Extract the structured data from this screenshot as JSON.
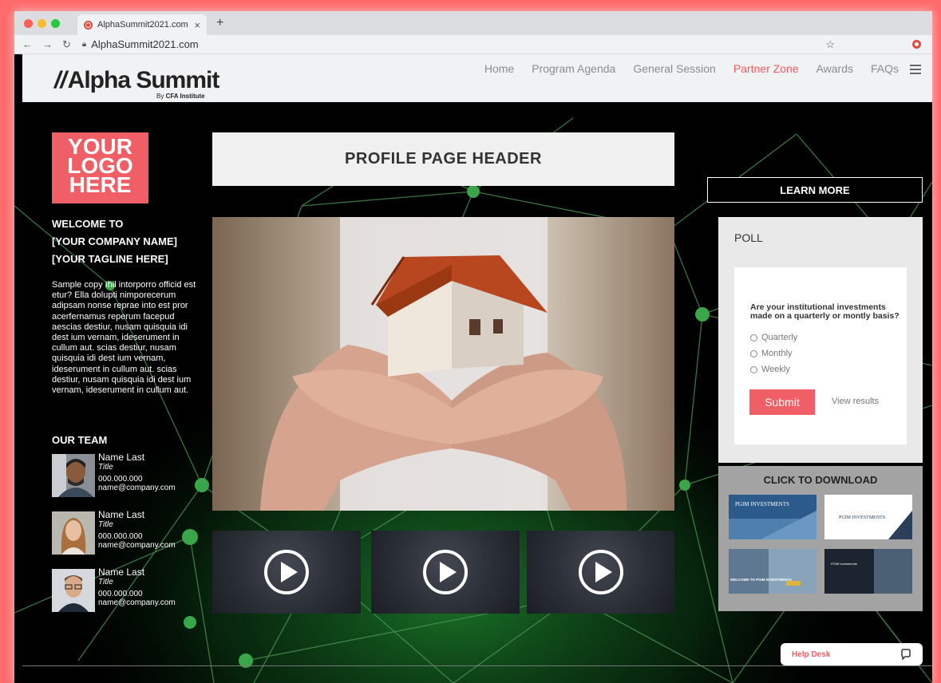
{
  "browser": {
    "tab_title": "AlphaSummit2021.com",
    "tab_close": "×",
    "new_tab": "+",
    "url": "AlphaSummit2021.com"
  },
  "site": {
    "logo_text": "Alpha Summit",
    "logo_sub_prefix": "By",
    "logo_sub_brand": "CFA Institute",
    "nav": [
      {
        "label": "Home",
        "active": false
      },
      {
        "label": "Program Agenda",
        "active": false
      },
      {
        "label": "General Session",
        "active": false
      },
      {
        "label": "Partner Zone",
        "active": true
      },
      {
        "label": "Awards",
        "active": false
      },
      {
        "label": "FAQs",
        "active": false
      }
    ]
  },
  "left": {
    "logo_placeholder": [
      "YOUR",
      "LOGO",
      "HERE"
    ],
    "welcome_lines": [
      "WELCOME TO",
      "[YOUR COMPANY NAME]",
      "[YOUR TAGLINE HERE]"
    ],
    "body_copy": "Sample copy Ihil intorporro officid est etur? Ella dolupti nimporecerum adipsam nonse reprae into est pror acerfernamus reperum facepud aescias destiur, nusam quisquia idi dest ium vernam, ideserument in cullum aut. scias destiur, nusam quisquia idi dest ium vernam, ideserument in cullum aut. scias destiur, nusam quisquia idi dest ium vernam, ideserument in cullum aut.",
    "team_title": "OUR TEAM",
    "team": [
      {
        "name": "Name Last",
        "title": "Title",
        "phone": "000.000.000",
        "email": "name@company.com"
      },
      {
        "name": "Name Last",
        "title": "Title",
        "phone": "000.000.000",
        "email": "name@company.com"
      },
      {
        "name": "Name Last",
        "title": "Title",
        "phone": "000.000.000",
        "email": "name@company.com"
      }
    ]
  },
  "center": {
    "header": "PROFILE PAGE HEADER"
  },
  "right": {
    "learn_more": "LEARN MORE",
    "poll": {
      "title": "POLL",
      "question": "Are your institutional investments made on a quarterly or montly basis?",
      "options": [
        "Quarterly",
        "Monthly",
        "Weekly"
      ],
      "submit": "Submit",
      "view_results": "View results"
    },
    "download": {
      "title": "CLICK TO DOWNLOAD",
      "thumbs": [
        "PGIM INVESTMENTS",
        "PGIM INVESTMENTS",
        "WELCOME TO PGIM INVESTMENTS",
        "PGIM Investments"
      ]
    }
  },
  "help_desk": "Help Desk",
  "colors": {
    "accent": "#ef5f65",
    "network": "#2f8a3e",
    "page_bg": "#000000"
  }
}
